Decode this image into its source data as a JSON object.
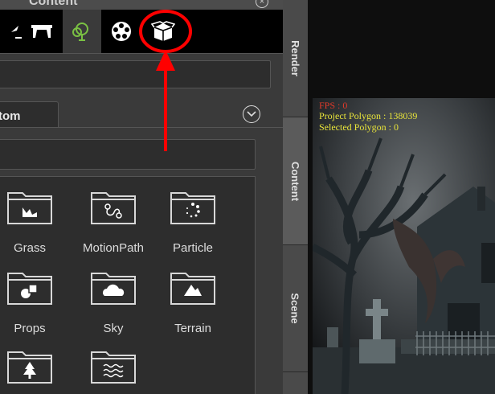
{
  "panel": {
    "title": "Content",
    "tabs": [
      {
        "name": "stage-tab",
        "icon": "stage-icon"
      },
      {
        "name": "set-tab",
        "icon": "set-icon",
        "selected": true
      },
      {
        "name": "motion-tab",
        "icon": "film-reel-icon"
      },
      {
        "name": "props-tab",
        "icon": "box-icon",
        "highlighted": true
      }
    ],
    "subtab_label": "tom",
    "items": [
      {
        "label": "Grass",
        "icon": "grass-icon"
      },
      {
        "label": "MotionPath",
        "icon": "motion-path-icon"
      },
      {
        "label": "Particle",
        "icon": "particle-icon"
      },
      {
        "label": "Props",
        "icon": "props-icon"
      },
      {
        "label": "Sky",
        "icon": "cloud-icon"
      },
      {
        "label": "Terrain",
        "icon": "mountain-icon"
      },
      {
        "label": "",
        "icon": "tree-icon"
      },
      {
        "label": "",
        "icon": "water-icon"
      }
    ]
  },
  "side_tabs": {
    "render": "Render",
    "content": "Content",
    "scene": "Scene"
  },
  "viewport": {
    "fps": "FPS : 0",
    "project_polygon": "Project Polygon : 138039",
    "selected_polygon": "Selected Polygon : 0"
  },
  "annotation": {
    "color": "#ff0000"
  }
}
